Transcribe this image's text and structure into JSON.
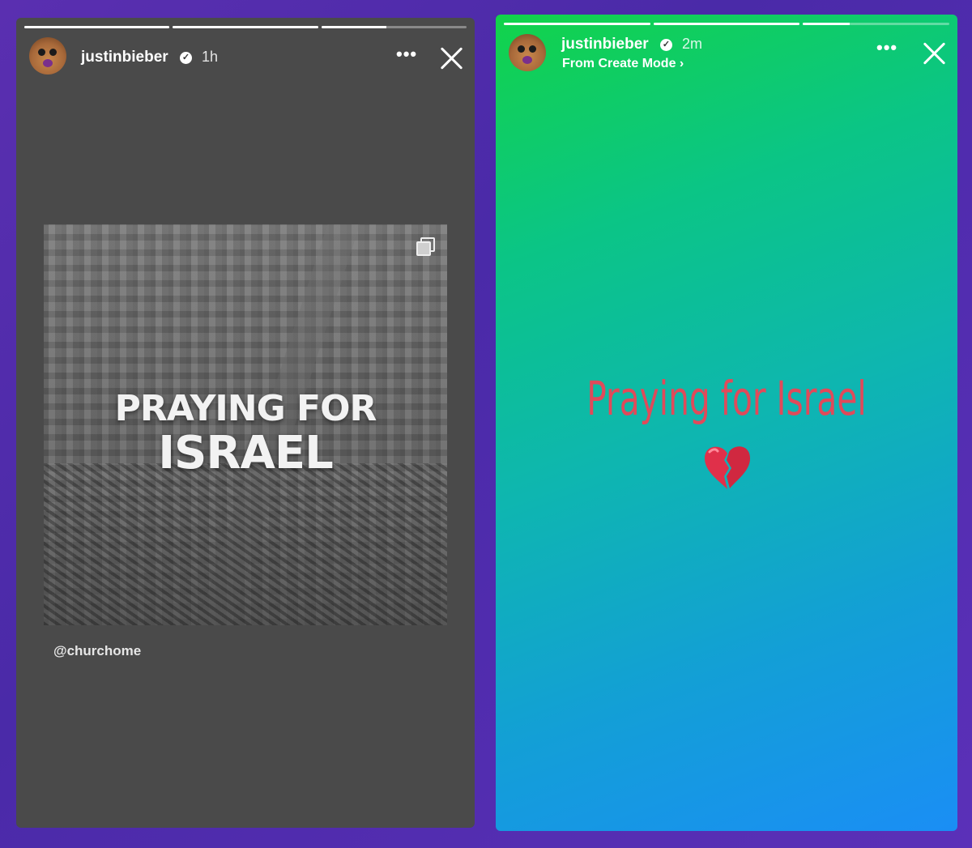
{
  "stories": [
    {
      "progress": [
        1,
        1,
        0.45
      ],
      "username": "justinbieber",
      "time": "1h",
      "more_label": "•••",
      "post": {
        "title_line1": "PRAYING FOR",
        "title_line2": "ISRAEL",
        "mention": "@churchome"
      }
    },
    {
      "progress": [
        1,
        1,
        0.32
      ],
      "username": "justinbieber",
      "time": "2m",
      "submeta": "From Create Mode ›",
      "more_label": "•••",
      "text": "Praying for Israel",
      "emoji": "broken-heart-icon"
    }
  ],
  "colors": {
    "page_bg": "#4a2aa8",
    "left_story_bg": "#4a4a4a",
    "gradient_start": "#12d34a",
    "gradient_end": "#1a8ef5",
    "story_text": "#e04a5a",
    "heart": "#e0304a"
  }
}
